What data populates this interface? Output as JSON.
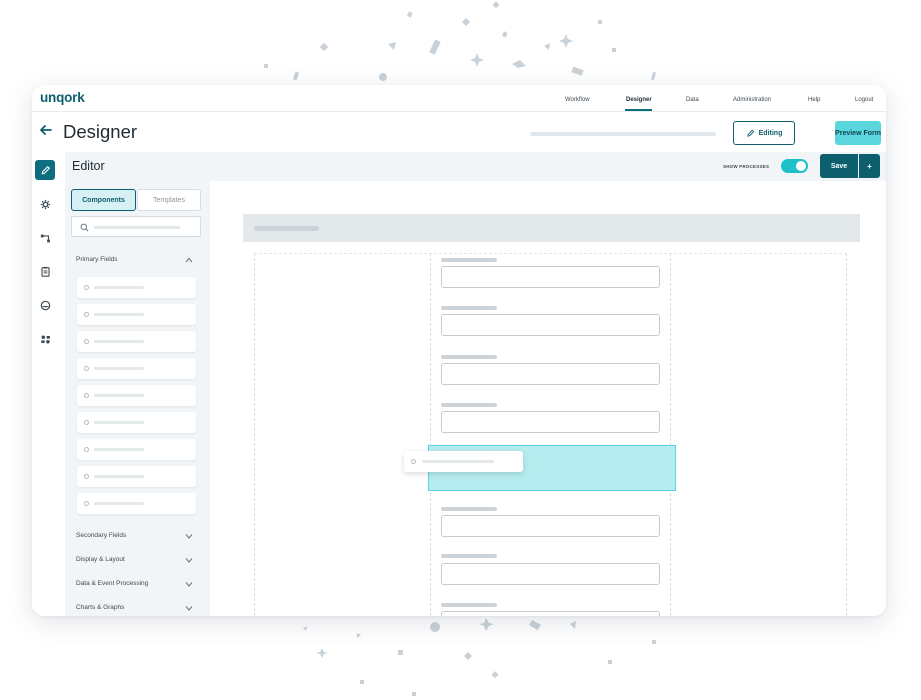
{
  "brand": {
    "logo": "unqork",
    "accent": "#0d6e80",
    "highlight": "#5ad6dc"
  },
  "nav": {
    "items": [
      "Workflow",
      "Designer",
      "Data",
      "Administration",
      "Help",
      "Logout"
    ],
    "active": "Designer"
  },
  "header": {
    "title": "Designer",
    "editing_label": "Editing",
    "preview_label": "Preview Form"
  },
  "rail": {
    "icons": [
      "pencil-icon",
      "gear-icon",
      "workflow-icon",
      "clipboard-icon",
      "palette-icon",
      "settings-sliders-icon"
    ]
  },
  "editor": {
    "title": "Editor",
    "show_processes_label": "SHOW PROCESSES",
    "show_processes_on": true,
    "save_label": "Save",
    "save_more_label": "+"
  },
  "panel": {
    "tabs": [
      "Components",
      "Templates"
    ],
    "active_tab": "Components",
    "sections": [
      "Primary Fields",
      "Secondary Fields",
      "Display & Layout",
      "Data & Event Processing",
      "Charts & Graphs"
    ]
  }
}
